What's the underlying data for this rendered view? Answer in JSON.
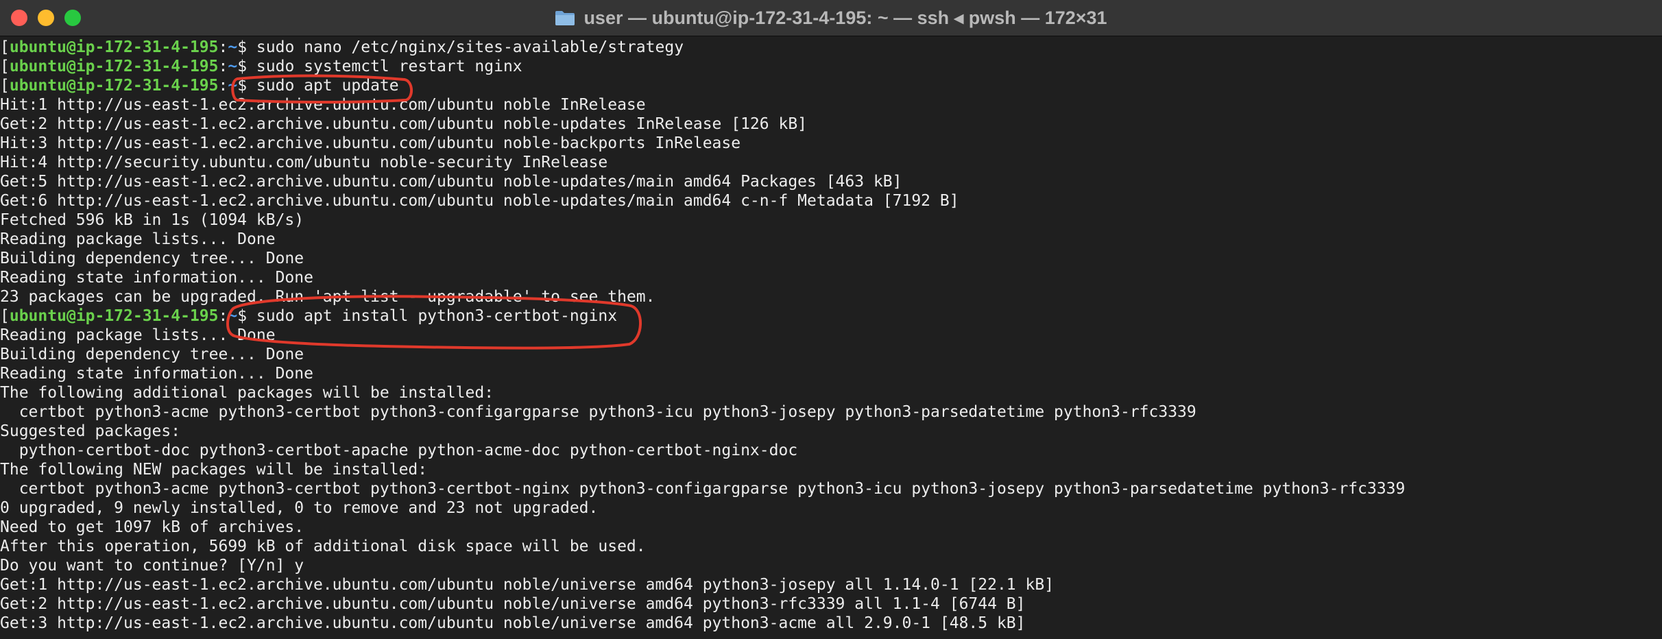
{
  "window": {
    "title": "user — ubuntu@ip-172-31-4-195: ~ — ssh ◂ pwsh — 172×31"
  },
  "terminal": {
    "lines": [
      {
        "prompt": true,
        "user": "ubuntu@ip-172-31-4-195",
        "path": "~",
        "command": "sudo nano /etc/nginx/sites-available/strategy"
      },
      {
        "prompt": true,
        "user": "ubuntu@ip-172-31-4-195",
        "path": "~",
        "command": "sudo systemctl restart nginx"
      },
      {
        "prompt": true,
        "user": "ubuntu@ip-172-31-4-195",
        "path": "~",
        "command": "sudo apt update"
      },
      {
        "text": "Hit:1 http://us-east-1.ec2.archive.ubuntu.com/ubuntu noble InRelease"
      },
      {
        "text": "Get:2 http://us-east-1.ec2.archive.ubuntu.com/ubuntu noble-updates InRelease [126 kB]"
      },
      {
        "text": "Hit:3 http://us-east-1.ec2.archive.ubuntu.com/ubuntu noble-backports InRelease"
      },
      {
        "text": "Hit:4 http://security.ubuntu.com/ubuntu noble-security InRelease"
      },
      {
        "text": "Get:5 http://us-east-1.ec2.archive.ubuntu.com/ubuntu noble-updates/main amd64 Packages [463 kB]"
      },
      {
        "text": "Get:6 http://us-east-1.ec2.archive.ubuntu.com/ubuntu noble-updates/main amd64 c-n-f Metadata [7192 B]"
      },
      {
        "text": "Fetched 596 kB in 1s (1094 kB/s)"
      },
      {
        "text": "Reading package lists... Done"
      },
      {
        "text": "Building dependency tree... Done"
      },
      {
        "text": "Reading state information... Done"
      },
      {
        "text": "23 packages can be upgraded. Run 'apt list --upgradable' to see them."
      },
      {
        "prompt": true,
        "user": "ubuntu@ip-172-31-4-195",
        "path": "~",
        "command": "sudo apt install python3-certbot-nginx"
      },
      {
        "text": "Reading package lists... Done"
      },
      {
        "text": "Building dependency tree... Done"
      },
      {
        "text": "Reading state information... Done"
      },
      {
        "text": "The following additional packages will be installed:"
      },
      {
        "text": "  certbot python3-acme python3-certbot python3-configargparse python3-icu python3-josepy python3-parsedatetime python3-rfc3339"
      },
      {
        "text": "Suggested packages:"
      },
      {
        "text": "  python-certbot-doc python3-certbot-apache python-acme-doc python-certbot-nginx-doc"
      },
      {
        "text": "The following NEW packages will be installed:"
      },
      {
        "text": "  certbot python3-acme python3-certbot python3-certbot-nginx python3-configargparse python3-icu python3-josepy python3-parsedatetime python3-rfc3339"
      },
      {
        "text": "0 upgraded, 9 newly installed, 0 to remove and 23 not upgraded."
      },
      {
        "text": "Need to get 1097 kB of archives."
      },
      {
        "text": "After this operation, 5699 kB of additional disk space will be used."
      },
      {
        "text": "Do you want to continue? [Y/n] y"
      },
      {
        "text": "Get:1 http://us-east-1.ec2.archive.ubuntu.com/ubuntu noble/universe amd64 python3-josepy all 1.14.0-1 [22.1 kB]"
      },
      {
        "text": "Get:2 http://us-east-1.ec2.archive.ubuntu.com/ubuntu noble/universe amd64 python3-rfc3339 all 1.1-4 [6744 B]"
      },
      {
        "text": "Get:3 http://us-east-1.ec2.archive.ubuntu.com/ubuntu noble/universe amd64 python3-acme all 2.9.0-1 [48.5 kB]"
      }
    ]
  },
  "colors": {
    "background": "#1f1f1f",
    "titlebar": "#353535",
    "prompt_user": "#6ad14c",
    "prompt_path": "#4f9cf0",
    "annotation": "#e0392b"
  }
}
